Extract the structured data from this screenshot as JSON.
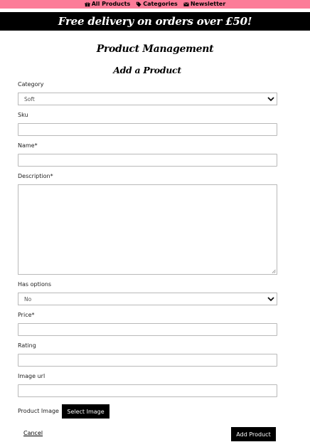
{
  "nav": {
    "items": [
      {
        "label": "All Products",
        "icon": "gift-icon"
      },
      {
        "label": "Categories",
        "icon": "tag-icon"
      },
      {
        "label": "Newsletter",
        "icon": "envelope-icon"
      }
    ],
    "background": "#fc7c98"
  },
  "banner": {
    "text": "Free delivery on orders over £50!"
  },
  "page": {
    "title": "Product Management",
    "form_title": "Add a Product"
  },
  "form": {
    "category": {
      "label": "Category",
      "value": "Soft"
    },
    "sku": {
      "label": "Sku",
      "value": ""
    },
    "name": {
      "label": "Name*",
      "value": ""
    },
    "description": {
      "label": "Description*",
      "value": ""
    },
    "has_options": {
      "label": "Has options",
      "value": "No"
    },
    "price": {
      "label": "Price*",
      "value": ""
    },
    "rating": {
      "label": "Rating",
      "value": ""
    },
    "image_url": {
      "label": "Image url",
      "value": ""
    },
    "product_image": {
      "label": "Product Image",
      "button": "Select Image"
    },
    "cancel": "Cancel",
    "submit": "Add Product"
  }
}
